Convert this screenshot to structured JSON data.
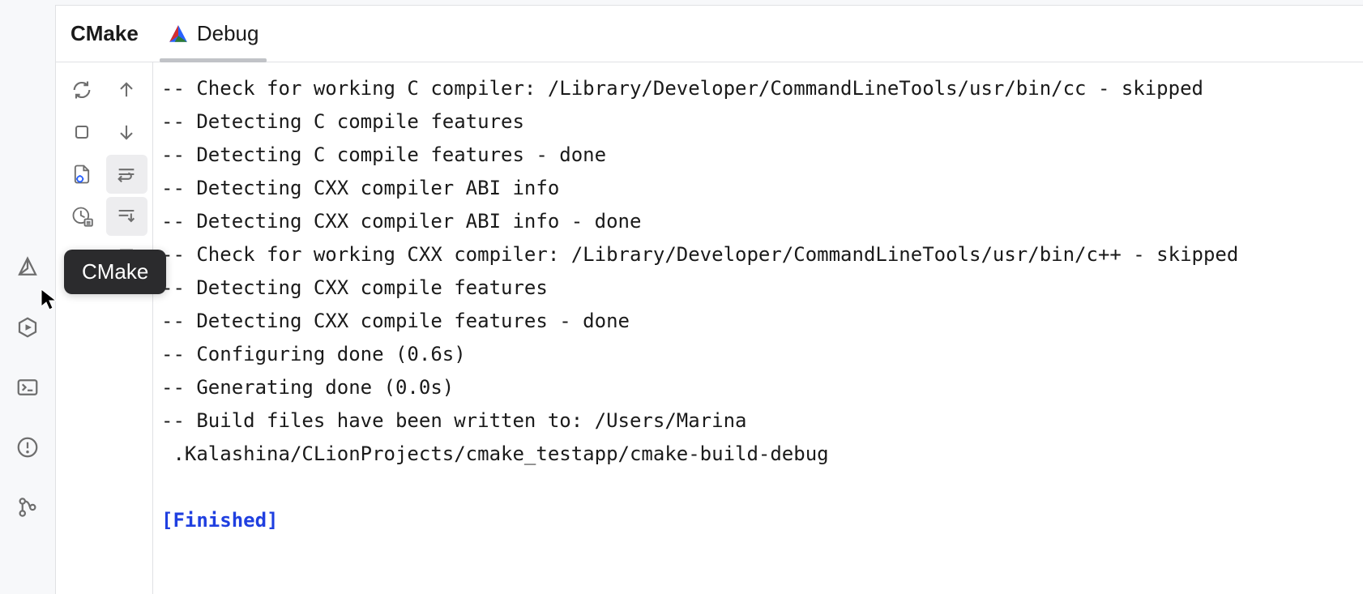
{
  "tabs": {
    "primary": "CMake",
    "sub": "Debug"
  },
  "tooltip": "CMake",
  "console": {
    "lines": [
      "-- Check for working C compiler: /Library/Developer/CommandLineTools/usr/bin/cc - skipped",
      "-- Detecting C compile features",
      "-- Detecting C compile features - done",
      "-- Detecting CXX compiler ABI info",
      "-- Detecting CXX compiler ABI info - done",
      "-- Check for working CXX compiler: /Library/Developer/CommandLineTools/usr/bin/c++ - skipped",
      "-- Detecting CXX compile features",
      "-- Detecting CXX compile features - done",
      "-- Configuring done (0.6s)",
      "-- Generating done (0.0s)",
      "-- Build files have been written to: /Users/Marina",
      " .Kalashina/CLionProjects/cmake_testapp/cmake-build-debug",
      ""
    ],
    "status": "[Finished]"
  }
}
